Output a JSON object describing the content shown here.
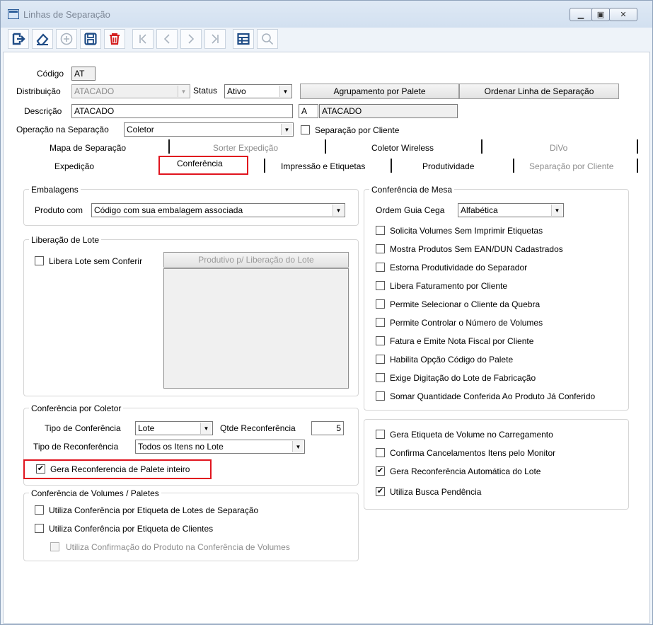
{
  "window": {
    "title": "Linhas de Separação",
    "controls": [
      "minimize",
      "maximize",
      "close"
    ]
  },
  "toolbar": {
    "buttons": [
      {
        "name": "exit-icon",
        "enabled": true
      },
      {
        "name": "eraser-icon",
        "enabled": true
      },
      {
        "name": "add-icon",
        "enabled": false
      },
      {
        "name": "save-icon",
        "enabled": true
      },
      {
        "name": "delete-icon",
        "enabled": true
      },
      {
        "name": "first-record-icon",
        "enabled": false
      },
      {
        "name": "previous-record-icon",
        "enabled": false
      },
      {
        "name": "next-record-icon",
        "enabled": false
      },
      {
        "name": "last-record-icon",
        "enabled": false
      },
      {
        "name": "grid-icon",
        "enabled": true
      },
      {
        "name": "search-icon",
        "enabled": false
      }
    ]
  },
  "form": {
    "codigo_label": "Código",
    "codigo_value": "AT",
    "distribuicao_label": "Distribuição",
    "distribuicao_value": "ATACADO",
    "status_label": "Status",
    "status_value": "Ativo",
    "agrupamento_button": "Agrupamento por Palete",
    "ordenar_button": "Ordenar Linha de Separação",
    "descricao_label": "Descrição",
    "descricao_value": "ATACADO",
    "sigla_value": "A",
    "sigla_desc_value": "ATACADO",
    "operacao_label": "Operação na Separação",
    "operacao_value": "Coletor",
    "separacao_cliente_label": "Separação por Cliente"
  },
  "tabs": {
    "row1": [
      "Mapa de Separação",
      "Sorter Expedição",
      "Coletor Wireless",
      "DiVo"
    ],
    "row2": [
      "Expedição",
      "Conferência",
      "Impressão e Etiquetas",
      "Produtividade",
      "Separação por Cliente"
    ],
    "active": "Conferência"
  },
  "embalagens": {
    "title": "Embalagens",
    "produto_label": "Produto com",
    "produto_value": "Código com sua embalagem associada"
  },
  "liberacao": {
    "title": "Liberação de Lote",
    "libera_label": "Libera Lote sem Conferir",
    "produtivo_button": "Produtivo p/ Liberação do Lote"
  },
  "coletor": {
    "title": "Conferência por Coletor",
    "tipo_conf_label": "Tipo de Conferência",
    "tipo_conf_value": "Lote",
    "qtde_label": "Qtde Reconferência",
    "qtde_value": "5",
    "tipo_reconf_label": "Tipo de Reconferência",
    "tipo_reconf_value": "Todos os Itens no Lote",
    "gera_palete_label": "Gera Reconferencia de Palete inteiro"
  },
  "volumes": {
    "title": "Conferência de Volumes / Paletes",
    "opt1": "Utiliza Conferência por Etiqueta de Lotes de Separação",
    "opt2": "Utiliza Conferência por Etiqueta de Clientes",
    "opt3": "Utiliza Confirmação do Produto na Conferência de Volumes"
  },
  "mesa": {
    "title": "Conferência de Mesa",
    "ordem_label": "Ordem Guia Cega",
    "ordem_value": "Alfabética",
    "options": [
      "Solicita Volumes Sem Imprimir Etiquetas",
      "Mostra Produtos Sem EAN/DUN Cadastrados",
      "Estorna Produtividade do Separador",
      "Libera Faturamento por Cliente",
      "Permite Selecionar o Cliente da Quebra",
      "Permite Controlar o Número de Volumes",
      "Fatura e Emite Nota Fiscal por Cliente",
      "Habilita Opção Código do Palete",
      "Exige Digitação do Lote de Fabricação",
      "Somar Quantidade Conferida Ao Produto Já Conferido"
    ]
  },
  "outros": {
    "options": [
      "Gera Etiqueta de Volume no Carregamento",
      "Confirma Cancelamentos Itens pelo Monitor",
      "Gera Reconferência Automática do Lote",
      "Utiliza Busca Pendência"
    ],
    "checked": [
      false,
      false,
      true,
      true
    ]
  },
  "check_mark": "✔"
}
